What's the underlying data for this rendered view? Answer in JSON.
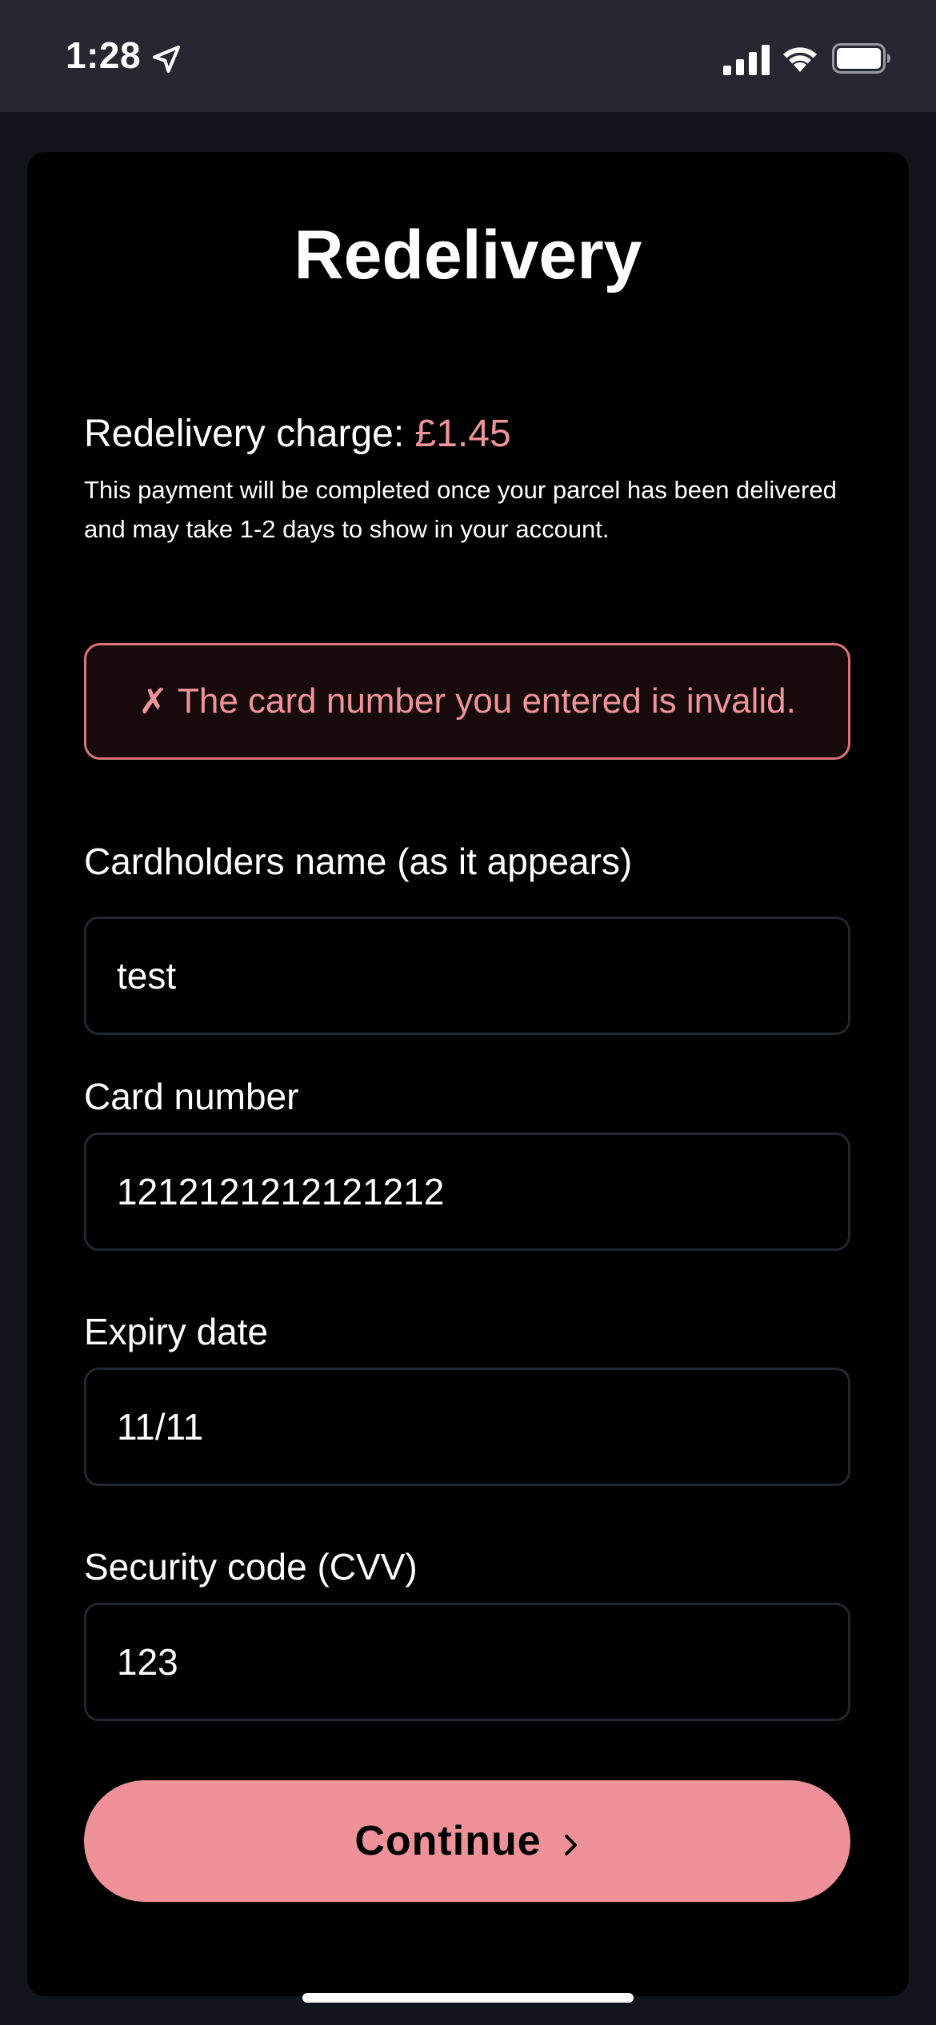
{
  "status_bar": {
    "time": "1:28"
  },
  "page": {
    "title": "Redelivery",
    "charge_label": "Redelivery charge: ",
    "charge_amount": "£1.45",
    "charge_note": "This payment will be completed once your parcel has been delivered and may take 1-2 days to show in your account."
  },
  "error": {
    "icon": "✗",
    "message": "The card number you entered is invalid."
  },
  "form": {
    "name_label": "Cardholders name (as it appears)",
    "name_value": "test",
    "card_label": "Card number",
    "card_value": "1212121212121212",
    "expiry_label": "Expiry date",
    "expiry_value": "11/11",
    "cvv_label": "Security code (CVV)",
    "cvv_value": "123"
  },
  "actions": {
    "continue_label": "Continue"
  },
  "colors": {
    "accent": "#ef9198",
    "error": "#ef949a",
    "background": "#000000",
    "status_bar": "#262730"
  },
  "icons": {
    "location": "location-arrow-icon",
    "signal": "cellular-signal-icon",
    "wifi": "wifi-icon",
    "battery": "battery-icon",
    "error": "cross-mark-icon",
    "chevron": "chevron-right-icon"
  }
}
